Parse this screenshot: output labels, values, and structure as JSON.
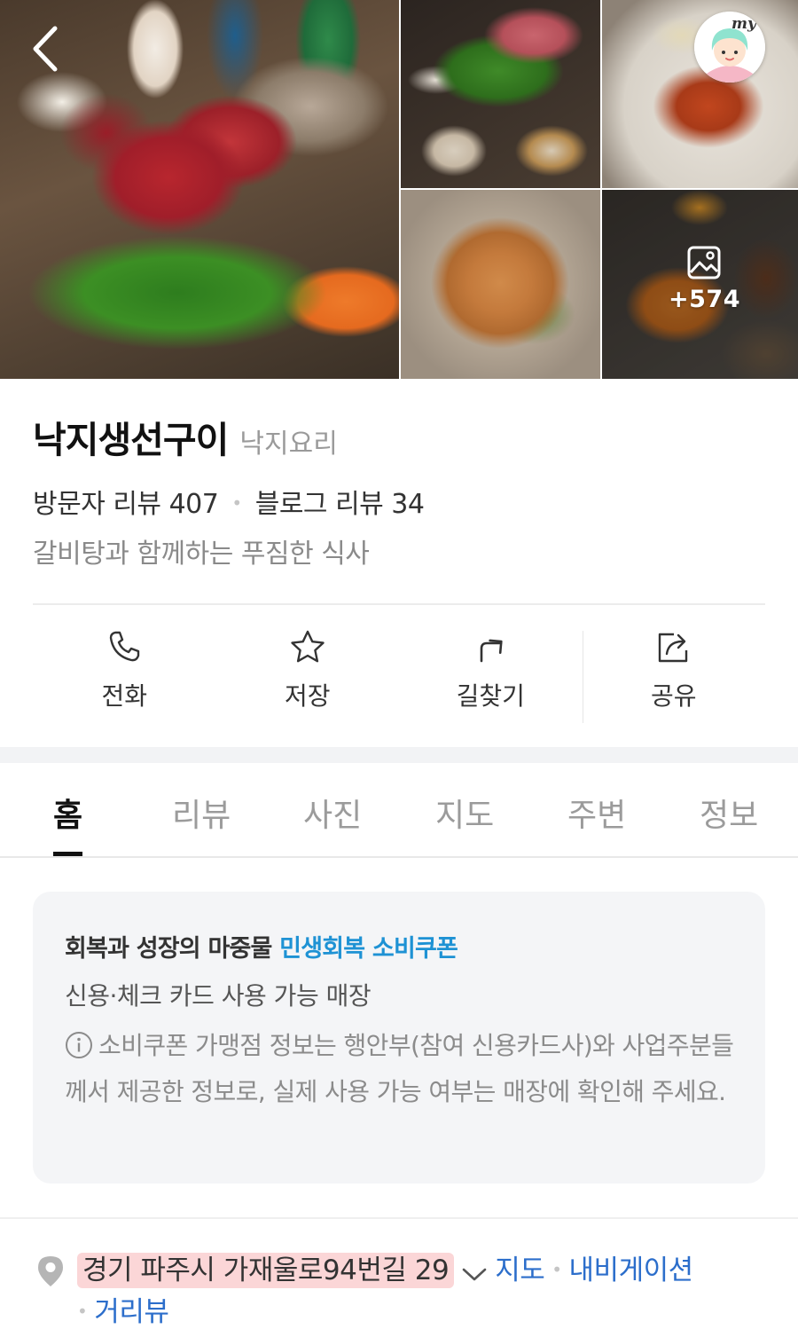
{
  "gallery": {
    "more_count": "+574"
  },
  "nav": {
    "my_label": "my"
  },
  "place": {
    "name": "낙지생선구이",
    "category": "낙지요리",
    "visitor_reviews": "방문자 리뷰 407",
    "blog_reviews": "블로그 리뷰 34",
    "description": "갈비탕과 함께하는 푸짐한 식사"
  },
  "actions": [
    {
      "label": "전화",
      "icon": "phone-icon"
    },
    {
      "label": "저장",
      "icon": "star-icon"
    },
    {
      "label": "길찾기",
      "icon": "directions-icon"
    },
    {
      "label": "공유",
      "icon": "share-icon"
    }
  ],
  "tabs": [
    {
      "label": "홈",
      "active": true
    },
    {
      "label": "리뷰"
    },
    {
      "label": "사진"
    },
    {
      "label": "지도"
    },
    {
      "label": "주변"
    },
    {
      "label": "정보"
    }
  ],
  "coupon": {
    "title": "회복과 성장의 마중물",
    "highlight": "민생회복 소비쿠폰",
    "subtitle": "신용·체크 카드 사용 가능 매장",
    "note": "소비쿠폰 가맹점 정보는 행안부(참여 신용카드사)와 사업주분들께서 제공한 정보로, 실제 사용 가능 여부는 매장에 확인해 주세요."
  },
  "address": {
    "text": "경기 파주시 가재울로94번길 29",
    "link_map": "지도",
    "link_navigation": "내비게이션",
    "link_street_view": "거리뷰"
  },
  "colors": {
    "highlight_blue": "#1e92d4",
    "link_blue": "#2c6ecb",
    "address_highlight": "#fbd6d7"
  }
}
